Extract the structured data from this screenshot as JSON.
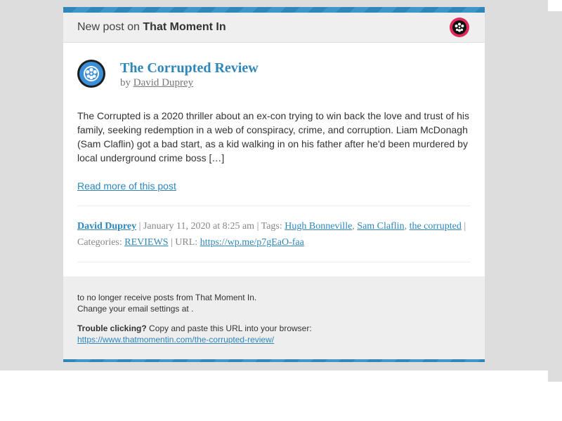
{
  "header": {
    "prefix": "New post on ",
    "site_name": "That Moment In",
    "logo_icon": "film-reel-icon"
  },
  "post": {
    "title": "The Corrupted Review",
    "by": "by ",
    "author": "David Duprey",
    "avatar_icon": "film-reel-icon",
    "excerpt": "The Corrupted is a 2020 thriller about an ex-con trying to win back the love and trust of his family, seeking redemption in a web of conspiracy, crime, and corruption. Liam McDonagh (Sam Claflin) got a bad start, as a kid walking in on his father after he'd been murdered by local underground crime boss […]",
    "read_more": "Read more of this post"
  },
  "meta": {
    "author": "David Duprey",
    "date": " | January 11, 2020 at 8:25 am | Tags: ",
    "tags": [
      "Hugh Bonneville",
      "Sam Claflin",
      "the corrupted"
    ],
    "tag_sep": ", ",
    "categories_label": " | Categories: ",
    "category": "REVIEWS",
    "url_label": " | URL: ",
    "url": "https://wp.me/p7gEaO-faa"
  },
  "footer": {
    "unsubscribe": "to no longer receive posts from That Moment In.",
    "settings": "Change your email settings at .",
    "trouble_bold": "Trouble clicking?",
    "trouble_text": " Copy and paste this URL into your browser:",
    "post_url": "https://www.thatmomentin.com/the-corrupted-review/"
  },
  "colors": {
    "accent": "#2e86b9",
    "logo_red": "#e0295a",
    "background": "#dddddd"
  }
}
